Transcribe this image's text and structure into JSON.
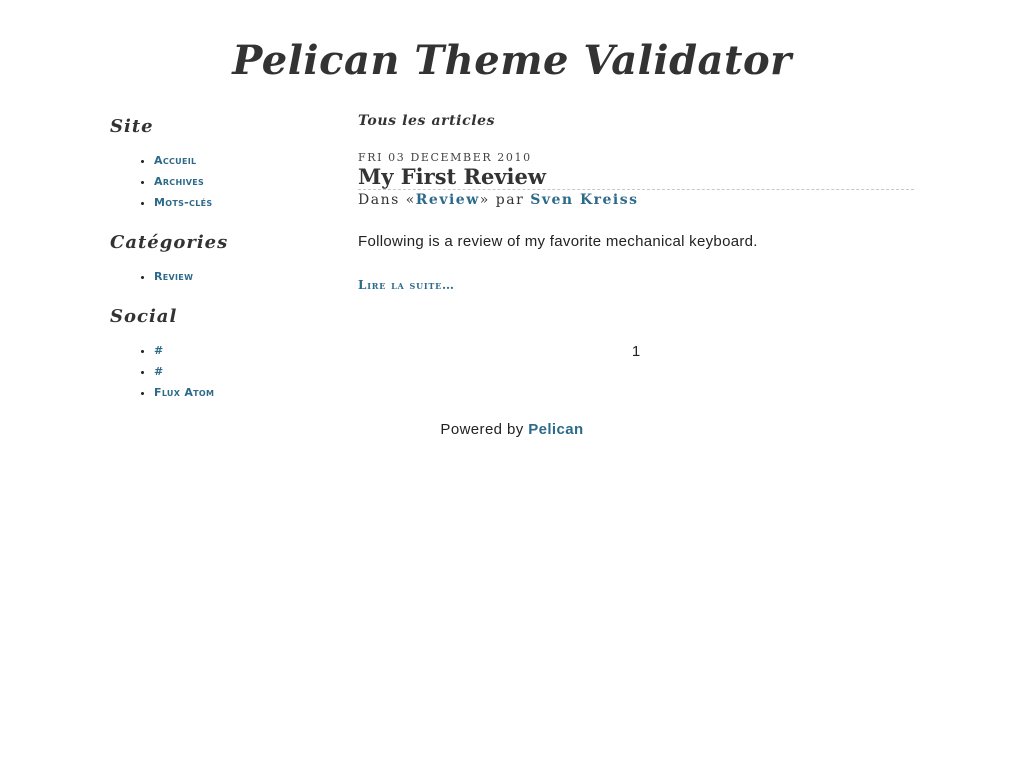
{
  "site": {
    "title": "Pelican Theme Validator"
  },
  "sidebar": {
    "site_heading": "Site",
    "site_links": [
      "Accueil",
      "Archives",
      "Mots-clés"
    ],
    "categories_heading": "Catégories",
    "category_links": [
      "Review"
    ],
    "social_heading": "Social",
    "social_links": [
      "#",
      "#",
      "Flux Atom"
    ]
  },
  "main": {
    "heading": "Tous les articles",
    "article": {
      "date": "Fri 03 December 2010",
      "title": "My First Review",
      "meta_prefix": "Dans «",
      "category": "Review",
      "meta_mid": "» par",
      "author": "Sven Kreiss",
      "summary": "Following is a review of my favorite mechanical keyboard.",
      "read_more": "Lire la suite…"
    },
    "pagination": {
      "current_page": "1"
    }
  },
  "footer": {
    "prefix": "Powered by",
    "link_label": "Pelican"
  },
  "colors": {
    "link": "#2d6a8a",
    "heading": "#333333",
    "text": "#222222",
    "divider": "#c8c8c8"
  }
}
